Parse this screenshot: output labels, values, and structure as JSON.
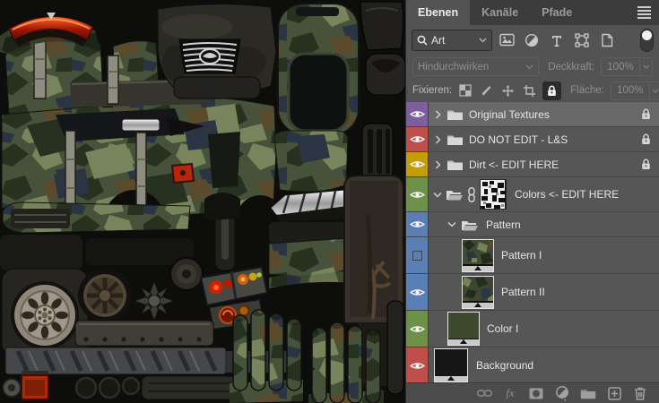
{
  "tabs": [
    {
      "label": "Ebenen",
      "active": true
    },
    {
      "label": "Kanäle",
      "active": false
    },
    {
      "label": "Pfade",
      "active": false
    }
  ],
  "filter": {
    "kind_value": "Art",
    "filter_icons": [
      "pixel-layers",
      "adjustment-layers",
      "type-layers",
      "shape-layers",
      "smart-objects"
    ],
    "filtering_toggle_on": true
  },
  "blend": {
    "mode": "Hindurchwirken",
    "opacity_label": "Deckkraft:",
    "opacity_value": "100%"
  },
  "lockbar": {
    "label": "Fixieren:",
    "lock_icons": [
      "lock-transparency",
      "lock-pixels",
      "lock-position",
      "lock-artboard",
      "lock-all"
    ],
    "fill_label": "Fläche:",
    "fill_value": "100%"
  },
  "layers": [
    {
      "label": "Original Textures",
      "badge": "#7e5f9e",
      "visible": true,
      "locked": true,
      "selected": true,
      "kind": "group-collapsed"
    },
    {
      "label": "DO NOT EDIT  - L&S",
      "badge": "#bf4f4a",
      "visible": true,
      "locked": true,
      "kind": "group-collapsed"
    },
    {
      "label": "Dirt <- EDIT HERE",
      "badge": "#c49d0a",
      "visible": true,
      "locked": true,
      "kind": "group-collapsed"
    },
    {
      "label": "Colors <- EDIT HERE",
      "badge": "#6d9148",
      "visible": true,
      "kind": "group-expanded-with-mask"
    },
    {
      "label": "Pattern",
      "badge": "#5a7fb4",
      "visible": true,
      "kind": "group-expanded"
    },
    {
      "label": "Pattern I",
      "badge": "#5a7fb4",
      "visible": false,
      "kind": "pattern-layer"
    },
    {
      "label": "Pattern II",
      "badge": "#5a7fb4",
      "visible": true,
      "kind": "pattern-layer"
    },
    {
      "label": "Color I",
      "badge": "#6d9148",
      "visible": true,
      "kind": "fill-layer",
      "thumb_color": "#3d4a2d"
    },
    {
      "label": "Background",
      "badge": "#bf4f4a",
      "visible": true,
      "kind": "image-layer",
      "thumb_color": "#161616"
    }
  ],
  "toolbar_icons": [
    "link-layers",
    "layer-effects",
    "add-mask",
    "new-adjustment-layer",
    "new-group",
    "new-layer",
    "delete-layer"
  ],
  "canvas_colors": {
    "background": "#0d0d0c",
    "camo_base": "#46523a",
    "camo_dark": "#27311f",
    "camo_light": "#78855c",
    "camo_navy": "#2b3442",
    "camo_brown": "#5c4a2c",
    "spoiler_red": "#c22a12"
  }
}
